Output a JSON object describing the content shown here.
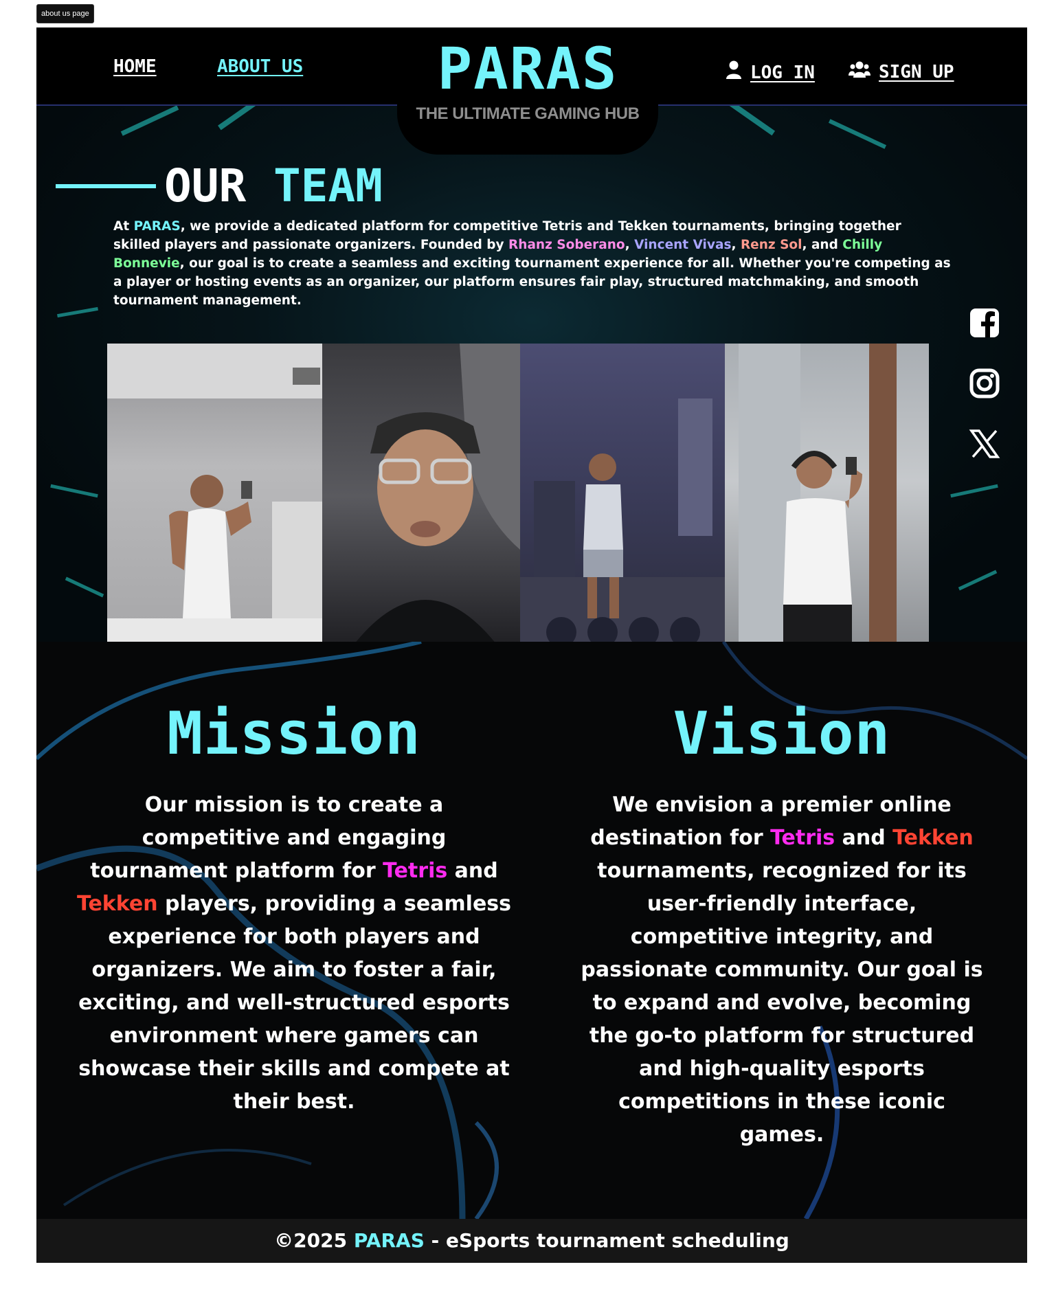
{
  "tab_label": "about us page",
  "nav": {
    "home": "HOME",
    "about": "ABOUT US",
    "login": "LOG IN",
    "signup": "SIGN UP",
    "login_icon": "user-icon",
    "signup_icon": "users-icon"
  },
  "logo": {
    "title": "PARAS",
    "subtitle": "THE ULTIMATE GAMING HUB"
  },
  "team": {
    "title_a": "OUR ",
    "title_b": "TEAM",
    "intro_1": "At ",
    "brand": "PARAS",
    "intro_2": ", we provide a dedicated platform for competitive Tetris and Tekken tournaments, bringing together skilled players and passionate organizers. Founded by ",
    "founder_1": "Rhanz Soberano",
    "sep_1": ", ",
    "founder_2": "Vincent Vivas",
    "sep_2": ", ",
    "founder_3": "Renz Sol",
    "sep_3": ", and ",
    "founder_4": "Chilly Bonnevie",
    "intro_3": ", our goal is to create a seamless and exciting tournament experience for all. Whether you're competing as a player or hosting events as an organizer, our platform ensures fair play, structured matchmaking, and smooth tournament management.",
    "photos": [
      "team-photo-1",
      "team-photo-2",
      "team-photo-3",
      "team-photo-4"
    ]
  },
  "social": [
    "facebook-icon",
    "instagram-icon",
    "x-icon"
  ],
  "mission": {
    "title": "Mission",
    "text_1": "Our mission is to create a competitive and engaging tournament platform for ",
    "tetris": "Tetris",
    "and": " and ",
    "tekken": "Tekken",
    "text_2": " players, providing a seamless experience for both players and organizers. We aim to foster a fair, exciting, and well-structured esports environment where gamers can showcase their skills and compete at their best."
  },
  "vision": {
    "title": "Vision",
    "text_1": "We envision a premier online destination for ",
    "tetris": "Tetris",
    "and": " and ",
    "tekken": "Tekken",
    "text_2": " tournaments, recognized for its user-friendly interface, competitive integrity, and passionate community. Our goal is to expand and evolve, becoming the go-to platform for structured and high-quality esports competitions in these iconic games."
  },
  "footer": {
    "prefix": "©2025 ",
    "brand": "PARAS",
    "suffix": " - eSports tournament scheduling"
  },
  "colors": {
    "accent": "#74f3fb",
    "tetris": "#ff2bf0",
    "tekken": "#ff4433",
    "background": "#000000"
  }
}
